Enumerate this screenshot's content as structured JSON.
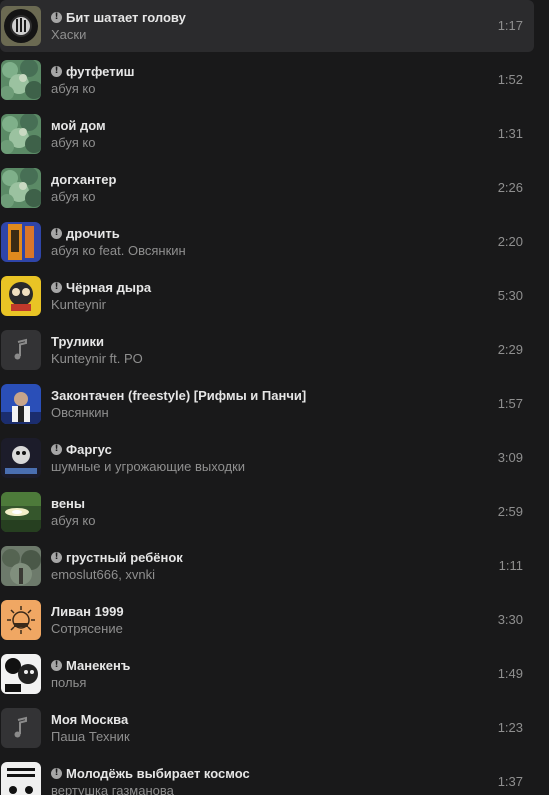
{
  "tracks": [
    {
      "title": "Бит шатает голову",
      "artist": "Хаски",
      "duration": "1:17",
      "explicit": true,
      "cover": "vinyl-portrait",
      "active": true
    },
    {
      "title": "футфетиш",
      "artist": "абуя ко",
      "duration": "1:52",
      "explicit": true,
      "cover": "green-foliage"
    },
    {
      "title": "мой дом",
      "artist": "абуя ко",
      "duration": "1:31",
      "explicit": false,
      "cover": "green-foliage"
    },
    {
      "title": "догхантер",
      "artist": "абуя ко",
      "duration": "2:26",
      "explicit": false,
      "cover": "green-foliage"
    },
    {
      "title": "дрочить",
      "artist": "абуя ко feat. Овсянкин",
      "duration": "2:20",
      "explicit": true,
      "cover": "blue-orange-poster"
    },
    {
      "title": "Чёрная дыра",
      "artist": "Kunteynir",
      "duration": "5:30",
      "explicit": true,
      "cover": "yellow-cartoon"
    },
    {
      "title": "Трулики",
      "artist": "Kunteynir ft. PO",
      "duration": "2:29",
      "explicit": false,
      "cover": "placeholder-note"
    },
    {
      "title": "Законтачен (freestyle) [Рифмы и Панчи]",
      "artist": "Овсянкин",
      "duration": "1:57",
      "explicit": false,
      "cover": "blue-portrait"
    },
    {
      "title": "Фаргус",
      "artist": "шумные и угрожающие выходки",
      "duration": "3:09",
      "explicit": true,
      "cover": "dark-collage"
    },
    {
      "title": "вены",
      "artist": "абуя ко",
      "duration": "2:59",
      "explicit": false,
      "cover": "green-light"
    },
    {
      "title": "грустный ребёнок",
      "artist": "emoslut666, xvnki",
      "duration": "1:11",
      "explicit": true,
      "cover": "grey-forest"
    },
    {
      "title": "Ливан 1999",
      "artist": "Сотрясение",
      "duration": "3:30",
      "explicit": false,
      "cover": "orange-sun"
    },
    {
      "title": "Манекенъ",
      "artist": "полья",
      "duration": "1:49",
      "explicit": true,
      "cover": "bw-faces"
    },
    {
      "title": "Моя Москва",
      "artist": "Паша Техник",
      "duration": "1:23",
      "explicit": false,
      "cover": "placeholder-note"
    },
    {
      "title": "Молодёжь выбирает космос",
      "artist": "вертушка газманова",
      "duration": "1:37",
      "explicit": true,
      "cover": "bw-text-poster"
    }
  ],
  "explicit_marker": "!",
  "colors": {
    "background": "#19191a",
    "active_row": "#2b2b2d",
    "title": "#e6e6e6",
    "secondary": "#8f8f8f"
  }
}
